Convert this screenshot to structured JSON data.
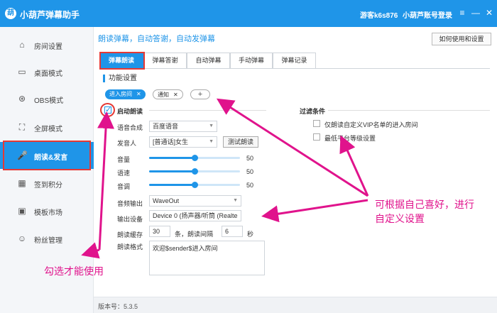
{
  "titlebar": {
    "logo": "葫",
    "title": "小葫芦弹幕助手",
    "guest": "游客k6s876",
    "login": "小葫芦账号登录",
    "menu": "≡",
    "minimize": "—",
    "close": "✕"
  },
  "sidebar": {
    "items": [
      {
        "label": "房间设置",
        "icon": "home-icon",
        "glyph": "⌂"
      },
      {
        "label": "桌面模式",
        "icon": "monitor-icon",
        "glyph": "▭"
      },
      {
        "label": "OBS模式",
        "icon": "obs-icon",
        "glyph": "⊛"
      },
      {
        "label": "全屏模式",
        "icon": "fullscreen-icon",
        "glyph": "⛶"
      },
      {
        "label": "朗读&发言",
        "icon": "microphone-icon",
        "glyph": "🎤"
      },
      {
        "label": "签到积分",
        "icon": "calendar-icon",
        "glyph": "▦"
      },
      {
        "label": "模板市场",
        "icon": "template-icon",
        "glyph": "▣"
      },
      {
        "label": "粉丝管理",
        "icon": "fans-icon",
        "glyph": "☺"
      }
    ]
  },
  "version": "版本号：5.3.5",
  "main": {
    "header": "朗读弹幕，自动答谢，自动发弹幕",
    "help_button": "如何使用和设置",
    "tabs": [
      "弹幕朗读",
      "弹幕答谢",
      "自动弹幕",
      "手动弹幕",
      "弹幕记录"
    ],
    "section_title": "功能设置",
    "chips": [
      {
        "label": "进入房间",
        "active": true
      },
      {
        "label": "通知",
        "active": false
      }
    ],
    "chip_add": "+",
    "enable_read": {
      "label": "启动朗读",
      "checked": true
    },
    "filter": {
      "title": "过滤条件",
      "vip_only": {
        "label": "仅朗读自定义VIP名单的进入房间",
        "checked": false
      },
      "min_level": {
        "label": "最低平台等级设置",
        "checked": false
      }
    },
    "tts": {
      "label": "语音合成",
      "value": "百度语音"
    },
    "speaker": {
      "label": "发音人",
      "value": "[普通话]女生"
    },
    "test_button": "测试朗读",
    "volume": {
      "label": "音量",
      "value": 50,
      "max": 100
    },
    "speed": {
      "label": "语速",
      "value": 50,
      "max": 100
    },
    "pitch": {
      "label": "音调",
      "value": 50,
      "max": 100
    },
    "audio_output": {
      "label": "音频输出",
      "value": "WaveOut"
    },
    "output_device": {
      "label": "输出设备",
      "value": "Device 0 (扬声器/听筒 (Realte"
    },
    "cache": {
      "label": "朗读缓存",
      "value": "30",
      "unit": "条，朗读间隔",
      "interval": "6",
      "interval_unit": "秒"
    },
    "format": {
      "label": "朗读格式",
      "value": "欢迎$sender$进入房间"
    }
  },
  "annotations": {
    "check_note": "勾选才能使用",
    "custom_note_line1": "可根据自己喜好，进行",
    "custom_note_line2": "自定义设置"
  },
  "colors": {
    "accent": "#1f95e8",
    "annotation": "#e0138c",
    "highlight_box": "#e53935"
  }
}
